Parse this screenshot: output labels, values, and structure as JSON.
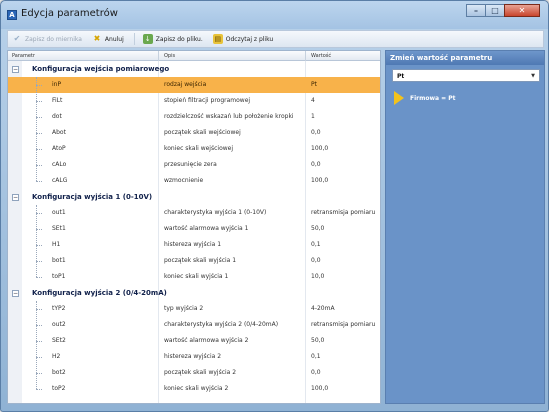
{
  "window": {
    "title": "Edycja parametrów",
    "controls": {
      "minimize": "–",
      "maximize": "□",
      "close": "✕"
    }
  },
  "toolbar": {
    "save_label": "Zapisz do pliku",
    "cancel_label": "Anuluj",
    "write_device_label": "Zapisz do pliku.",
    "read_file_label": "Odczytaj z pliku",
    "disabled_label": "Zapisz do miernika"
  },
  "grid": {
    "headers": {
      "param": "Parametr",
      "desc": "Opis",
      "value": "Wartość"
    },
    "groups": [
      {
        "label": "Konfiguracja wejścia pomiarowego",
        "rows": [
          {
            "name": "inP",
            "desc": "rodzaj wejścia",
            "value": "Pt",
            "selected": true
          },
          {
            "name": "FiLt",
            "desc": "stopień filtracji programowej",
            "value": "4"
          },
          {
            "name": "dot",
            "desc": "rozdzielczość wskazań lub położenie kropki",
            "value": "1"
          },
          {
            "name": "Abot",
            "desc": "początek skali wejściowej",
            "value": "0,0"
          },
          {
            "name": "AtoP",
            "desc": "koniec skali wejściowej",
            "value": "100,0"
          },
          {
            "name": "cALo",
            "desc": "przesunięcie zera",
            "value": "0,0"
          },
          {
            "name": "cALG",
            "desc": "wzmocnienie",
            "value": "100,0"
          }
        ]
      },
      {
        "label": "Konfiguracja wyjścia 1 (0-10V)",
        "rows": [
          {
            "name": "out1",
            "desc": "charakterystyka wyjścia 1 (0-10V)",
            "value": "retransmisja pomiaru"
          },
          {
            "name": "SEt1",
            "desc": "wartość alarmowa wyjścia 1",
            "value": "50,0"
          },
          {
            "name": "H1",
            "desc": "histereza wyjścia 1",
            "value": "0,1"
          },
          {
            "name": "bot1",
            "desc": "początek skali wyjścia 1",
            "value": "0,0"
          },
          {
            "name": "toP1",
            "desc": "koniec skali wyjścia 1",
            "value": "10,0"
          }
        ]
      },
      {
        "label": "Konfiguracja wyjścia 2 (0/4-20mA)",
        "rows": [
          {
            "name": "tYP2",
            "desc": "typ wyjścia 2",
            "value": "4-20mA"
          },
          {
            "name": "out2",
            "desc": "charakterystyka wyjścia 2 (0/4-20mA)",
            "value": "retransmisja pomiaru"
          },
          {
            "name": "SEt2",
            "desc": "wartość alarmowa wyjścia 2",
            "value": "50,0"
          },
          {
            "name": "H2",
            "desc": "histereza wyjścia 2",
            "value": "0,1"
          },
          {
            "name": "bot2",
            "desc": "początek skali wyjścia 2",
            "value": "0,0"
          },
          {
            "name": "toP2",
            "desc": "koniec skali wyjścia 2",
            "value": "100,0"
          }
        ]
      }
    ]
  },
  "panel": {
    "title": "Zmień wartość parametru",
    "select_value": "Pt",
    "factory_text": "Firmowa = Pt"
  },
  "colors": {
    "selection": "#f8b24a",
    "panel_bg": "#6a93c8",
    "group_text": "#10204a"
  }
}
